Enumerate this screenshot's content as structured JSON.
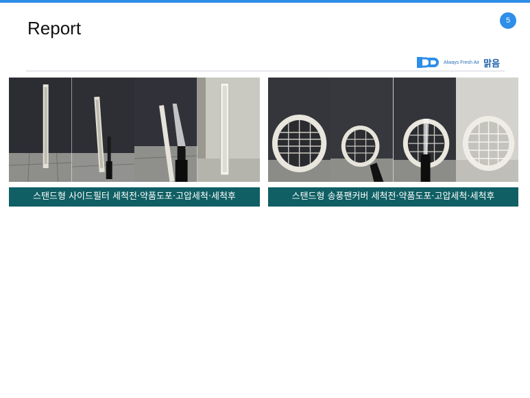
{
  "slide": {
    "title": "Report",
    "page_number": "5",
    "accent_color": "#2e8ee8"
  },
  "logo": {
    "tagline": "Always Fresh Air",
    "brand_ko": "맑음",
    "icon": "brand-logo-icon"
  },
  "sections": [
    {
      "caption": "스탠드형 사이드필터 세척전·약품도포·고압세척·세척후",
      "caption_color": "#0f5f64",
      "photos": [
        "before-cleaning-photo",
        "chemical-application-photo",
        "high-pressure-wash-photo",
        "after-cleaning-photo"
      ]
    },
    {
      "caption": "스탠드형 송풍팬커버 세척전·약품도포·고압세척·세척후",
      "caption_color": "#0f5f64",
      "photos": [
        "before-cleaning-photo",
        "chemical-application-photo",
        "high-pressure-wash-photo",
        "after-cleaning-photo"
      ]
    }
  ]
}
